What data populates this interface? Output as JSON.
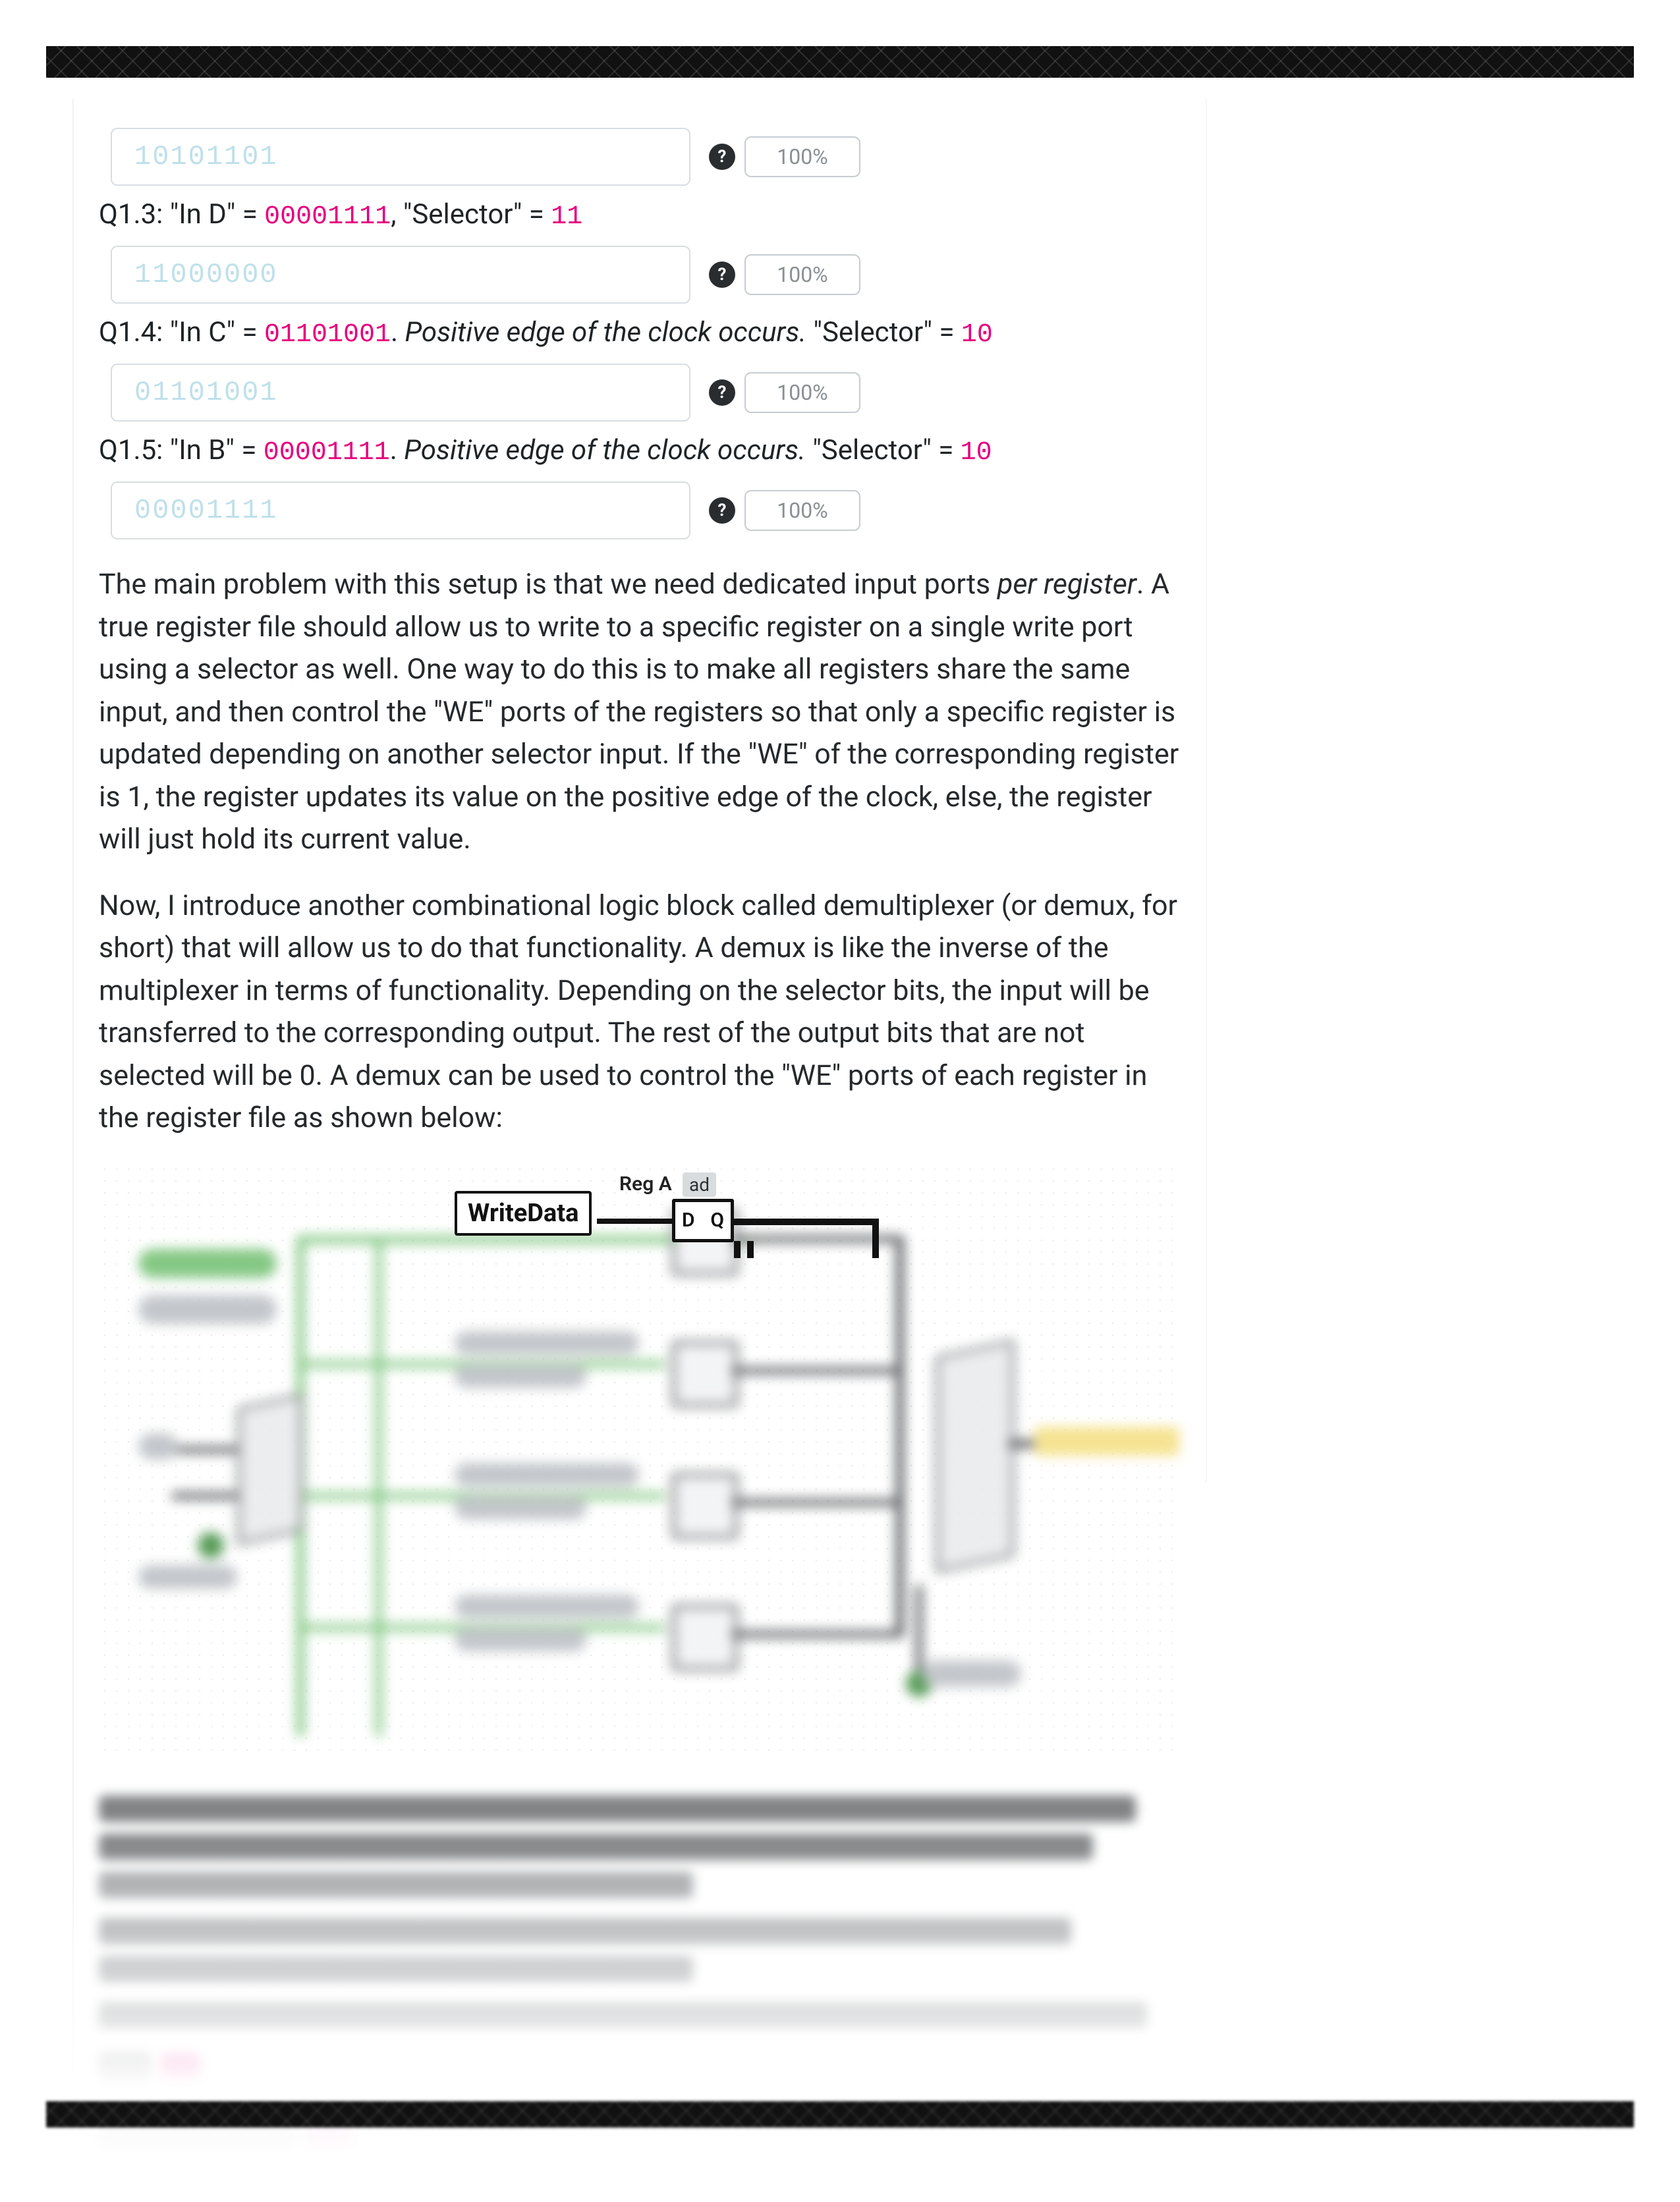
{
  "rows": [
    {
      "answer": "10101101",
      "pct": "100%"
    },
    {
      "answer": "11000000",
      "pct": "100%"
    },
    {
      "answer": "01101001",
      "pct": "100%"
    },
    {
      "answer": "00001111",
      "pct": "100%"
    }
  ],
  "q13": {
    "prefix": "Q1.3: \"In D\" = ",
    "code1": "00001111",
    "mid": ", \"Selector\" = ",
    "code2": "11"
  },
  "q14": {
    "prefix": "Q1.4: \"In C\" = ",
    "code1": "01101001",
    "dot": ". ",
    "ital": "Positive edge of the clock occurs.",
    "post": " \"Selector\" = ",
    "code2": "10"
  },
  "q15": {
    "prefix": "Q1.5: \"In B\" = ",
    "code1": "00001111",
    "dot": ". ",
    "ital": "Positive edge of the clock occurs.",
    "post": " \"Selector\" = ",
    "code2": "10"
  },
  "para1_a": "The main problem with this setup is that we need dedicated input ports ",
  "para1_i": "per register",
  "para1_b": ". A true register file should allow us to write to a specific register on a single write port using a selector as well. One way to do this is to make all registers share the same input, and then control the \"WE\" ports of the registers so that only a specific register is updated depending on another selector input. If the \"WE\" of the corresponding register is 1, the register updates its value on the positive edge of the clock, else, the register will just hold its current value.",
  "para2": "Now, I introduce another combinational logic block called demultiplexer (or demux, for short) that will allow us to do that functionality. A demux is like the inverse of the multiplexer in terms of functionality. Depending on the selector bits, the input will be transferred to the corresponding output. The rest of the output bits that are not selected will be 0. A demux can be used to control the \"WE\" ports of each register in the register file as shown below:",
  "fig": {
    "write_data": "WriteData",
    "rega": "Reg A",
    "ad": "ad",
    "D": "D",
    "Q": "Q"
  },
  "help_glyph": "?"
}
